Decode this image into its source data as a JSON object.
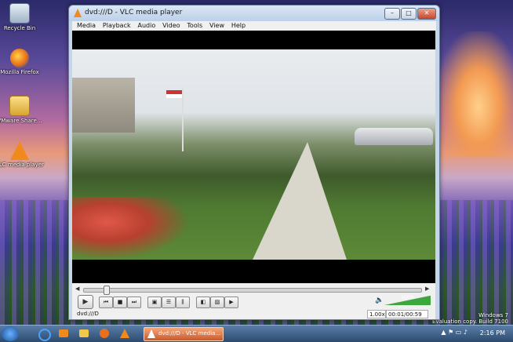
{
  "desktop": {
    "icons": [
      {
        "label": "Recycle Bin",
        "icon": "recycle-bin-icon"
      },
      {
        "label": "Mozilla Firefox",
        "icon": "firefox-icon"
      },
      {
        "label": "VMware Share...",
        "icon": "folder-icon"
      },
      {
        "label": "VLC media player",
        "icon": "vlc-cone-icon"
      }
    ],
    "watermark_line1": "Windows 7",
    "watermark_line2": "Evaluation copy. Build 7100"
  },
  "window": {
    "title": "dvd:///D - VLC media player",
    "minimize_label": "–",
    "maximize_label": "□",
    "close_label": "✕"
  },
  "menu": [
    "Media",
    "Playback",
    "Audio",
    "Video",
    "Tools",
    "View",
    "Help"
  ],
  "controls": {
    "seek_position": 0.06,
    "volume_percent": "100%",
    "volume_level": 1.0
  },
  "status": {
    "mrl": "dvd:///D",
    "speed": "1.00x",
    "time": "00:01/00:59"
  },
  "taskbar": {
    "active_app": "dvd:///D - VLC media...",
    "clock": "2:16 PM"
  },
  "colors": {
    "accent": "#c85a2c",
    "vlc_orange": "#f08a1c",
    "volume_green": "#3aa83a"
  }
}
